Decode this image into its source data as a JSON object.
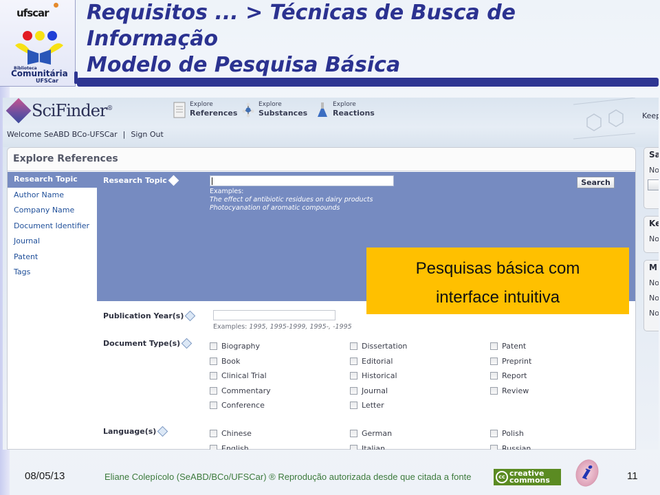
{
  "slide": {
    "title_line1": "Requisitos ... > Técnicas de Busca de",
    "title_line2": "Informação",
    "title_line3": "Modelo de Pesquisa Básica",
    "logo": {
      "top_mark": "ufscar",
      "lib_small": "Biblioteca",
      "lib_big": "Comunitária",
      "lib_ufscar": "UFSCar"
    },
    "callout": {
      "line1": "Pesquisas básica com",
      "line2": "interface intuitiva",
      "color": "#ffc000"
    },
    "footer": {
      "date": "08/05/13",
      "credit": "Eliane Colepícolo (SeABD/BCo/UFSCar) ® Reprodução autorizada desde que citada a fonte",
      "cc_icon": "cc",
      "cc_line1": "creative",
      "cc_line2": "commons",
      "info_logo": "i",
      "page_number": "11"
    },
    "accent_color": "#2b3290"
  },
  "scifinder": {
    "logo_text": "SciFinder",
    "logo_reg": "®",
    "nav": [
      {
        "small": "Explore",
        "big": "References",
        "icon": "document-icon"
      },
      {
        "small": "Explore",
        "big": "Substances",
        "icon": "molecule-icon"
      },
      {
        "small": "Explore",
        "big": "Reactions",
        "icon": "flask-icon"
      }
    ],
    "welcome": "Welcome SeABD BCo-UFSCar",
    "separator": "|",
    "sign_out": "Sign Out",
    "keep_text": "Keep",
    "panel_title": "Explore References",
    "side_menu": [
      {
        "label": "Research Topic",
        "active": true
      },
      {
        "label": "Author Name"
      },
      {
        "label": "Company Name"
      },
      {
        "label": "Document Identifier"
      },
      {
        "label": "Journal"
      },
      {
        "label": "Patent"
      },
      {
        "label": "Tags"
      }
    ],
    "research_topic": {
      "label": "Research Topic",
      "input_value": "",
      "examples_label": "Examples:",
      "examples": [
        "The effect of antibiotic residues on dairy products",
        "Photocyanation of aromatic compounds"
      ],
      "search_label": "Search"
    },
    "publication_years": {
      "label": "Publication Year(s)",
      "input_value": "",
      "examples_label": "Examples:",
      "examples": "1995, 1995-1999, 1995-, -1995"
    },
    "document_types": {
      "label": "Document Type(s)",
      "col1": [
        "Biography",
        "Book",
        "Clinical Trial",
        "Commentary",
        "Conference"
      ],
      "col2": [
        "Dissertation",
        "Editorial",
        "Historical",
        "Journal",
        "Letter"
      ],
      "col3": [
        "Patent",
        "Preprint",
        "Report",
        "Review"
      ]
    },
    "languages": {
      "label": "Language(s)",
      "col1": [
        "Chinese",
        "English"
      ],
      "col2": [
        "German",
        "Italian"
      ],
      "col3": [
        "Polish",
        "Russian"
      ]
    },
    "right_rail": {
      "box1": {
        "head": "Sa",
        "lines": [
          "No"
        ]
      },
      "box2": {
        "head": "Ke",
        "lines": [
          "No"
        ]
      },
      "box3": {
        "head": "M",
        "lines": [
          "No",
          "No",
          "No"
        ]
      }
    },
    "colors": {
      "topic_bg": "#768bc1",
      "link": "#1f4f99"
    }
  }
}
